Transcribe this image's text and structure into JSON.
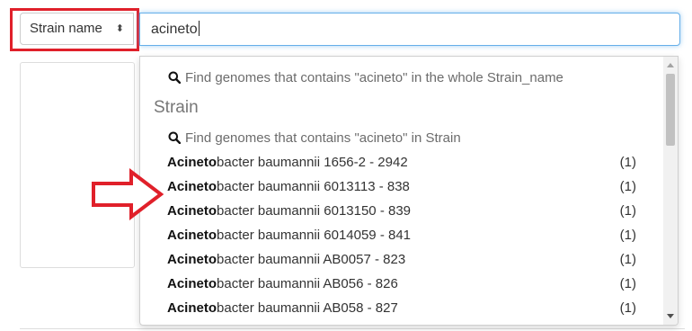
{
  "filter": {
    "field_label": "Strain name",
    "field_caret": "⬍",
    "query": "acineto"
  },
  "dropdown": {
    "find_all_text": "Find genomes that contains \"acineto\" in the whole Strain_name",
    "group_header": "Strain",
    "find_group_text": "Find genomes that contains \"acineto\" in Strain",
    "items": [
      {
        "match": "Acineto",
        "rest": "bacter baumannii 1656-2 - 2942",
        "count": "(1)"
      },
      {
        "match": "Acineto",
        "rest": "bacter baumannii 6013113 - 838",
        "count": "(1)"
      },
      {
        "match": "Acineto",
        "rest": "bacter baumannii 6013150 - 839",
        "count": "(1)"
      },
      {
        "match": "Acineto",
        "rest": "bacter baumannii 6014059 - 841",
        "count": "(1)"
      },
      {
        "match": "Acineto",
        "rest": "bacter baumannii AB0057 - 823",
        "count": "(1)"
      },
      {
        "match": "Acineto",
        "rest": "bacter baumannii AB056 - 826",
        "count": "(1)"
      },
      {
        "match": "Acineto",
        "rest": "bacter baumannii AB058 - 827",
        "count": "(1)"
      }
    ]
  },
  "colors": {
    "highlight": "#e0202a",
    "focus_border": "#66afe9"
  }
}
